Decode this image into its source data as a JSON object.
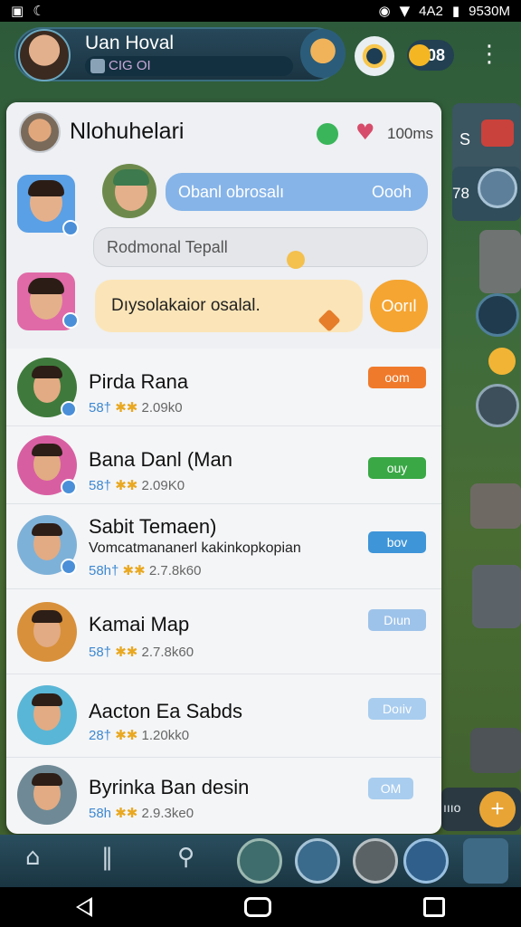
{
  "status_bar": {
    "time": "9530M",
    "signal": "4A2"
  },
  "header": {
    "name": "Uan Hoval",
    "subtitle": "CIG OI",
    "coin_label": "08"
  },
  "chat": {
    "group_name": "Nlohuhelari",
    "member_count": "100ms",
    "blue_message": "Obanl obrosalı",
    "blue_message_right": "Oooh",
    "input_placeholder": "Rodmonal Tepall",
    "yellow_message": "Dıysolakaior osalal.",
    "accept_label": "Oorıl"
  },
  "contacts": [
    {
      "name": "Pirda Rana",
      "meta_lead": "58†",
      "meta_stars": "✱✱",
      "meta_value": "2.09k0",
      "tag": "oom",
      "tag_color": "#f07a2b"
    },
    {
      "name": "Bana Danl (Man",
      "meta_lead": "58†",
      "meta_stars": "✱✱",
      "meta_value": "2.09K0",
      "tag": "ouy",
      "tag_color": "#39a845"
    },
    {
      "name": "Sabit Temaen)",
      "subtitle": "Vomcatmananerl kakinkopkopian",
      "meta_lead": "58h†",
      "meta_stars": "✱✱",
      "meta_value": "2.7.8k60",
      "tag": "bov",
      "tag_color": "#3e95d8"
    },
    {
      "name": "Kamai Map",
      "meta_lead": "58†",
      "meta_stars": "✱✱",
      "meta_value": "2.7.8k60",
      "tag": "Dıun",
      "tag_color": "#9ec3ea"
    },
    {
      "name": "Aacton Ea Sabds",
      "meta_lead": "28†",
      "meta_stars": "✱✱",
      "meta_value": "1.20kk0",
      "tag": "Doıiv",
      "tag_color": "#a9cdef"
    },
    {
      "name": "Byrinka Ban desin",
      "meta_lead": "58h",
      "meta_stars": "✱✱",
      "meta_value": "2.9.3ke0",
      "tag": "OM",
      "tag_color": "#a9cdef"
    }
  ],
  "side_hud": {
    "top_label": "S",
    "mid_label": "78",
    "bottom_label": "ıııo"
  },
  "colors": {
    "panel": "#f4f5f7",
    "accent_orange": "#f5a532",
    "accent_blue": "#86b4e8"
  }
}
